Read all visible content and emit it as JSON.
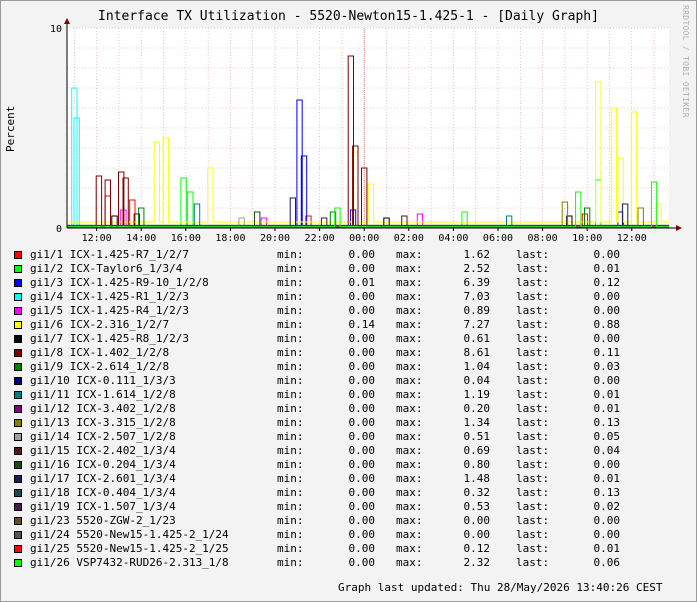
{
  "title": "Interface TX Utilization - 5520-Newton15-1.425-1 - [Daily Graph]",
  "side_text": "RRDTOOL / TOBI OETIKER",
  "labels": {
    "min": "min:",
    "max": "max:",
    "last": "last:"
  },
  "footer": "Graph last updated: Thu 28/May/2026 13:40:26 CEST",
  "chart_data": {
    "type": "line",
    "ylabel": "Percent",
    "ylim": [
      0,
      10
    ],
    "y_ticks": [
      "0",
      "10"
    ],
    "x_range_hours": [
      10.67,
      37.67
    ],
    "x_ticks": [
      {
        "label": "12:00",
        "h": 12
      },
      {
        "label": "14:00",
        "h": 14
      },
      {
        "label": "16:00",
        "h": 16
      },
      {
        "label": "18:00",
        "h": 18
      },
      {
        "label": "20:00",
        "h": 20
      },
      {
        "label": "22:00",
        "h": 22
      },
      {
        "label": "00:00",
        "h": 24
      },
      {
        "label": "02:00",
        "h": 26
      },
      {
        "label": "04:00",
        "h": 28
      },
      {
        "label": "06:00",
        "h": 30
      },
      {
        "label": "08:00",
        "h": 32
      },
      {
        "label": "10:00",
        "h": 34
      },
      {
        "label": "12:00",
        "h": 36
      }
    ],
    "midnight_hour": 24,
    "colors": {
      "background": "#ffffff",
      "grid": "#e0a0a0",
      "midnight": "#e06060",
      "axis": "#000000",
      "arrow": "#800000"
    },
    "series": [
      {
        "name": "gi1/1 ICX-1.425-R7_1/2/7",
        "color": "#ff0000",
        "min": "0.00",
        "max": "1.62",
        "last": "0.00",
        "peaks": [
          [
            12.5,
            1.6
          ],
          [
            13.6,
            1.4
          ],
          [
            21.5,
            0.6
          ],
          [
            33.9,
            0.7
          ]
        ]
      },
      {
        "name": "gi1/2 ICX-Taylor6_1/3/4",
        "color": "#00ff00",
        "min": "0.00",
        "max": "2.52",
        "last": "0.01",
        "peaks": [
          [
            15.9,
            2.5
          ],
          [
            16.2,
            1.8
          ],
          [
            28.5,
            0.8
          ],
          [
            34.5,
            2.4
          ]
        ]
      },
      {
        "name": "gi1/3 ICX-1.425-R9-10_1/2/8",
        "color": "#0000ff",
        "min": "0.01",
        "max": "6.39",
        "last": "0.12",
        "peaks": [
          [
            21.1,
            6.4
          ],
          [
            21.3,
            3.6
          ],
          [
            23.5,
            0.9
          ],
          [
            35.5,
            0.8
          ]
        ]
      },
      {
        "name": "gi1/4 ICX-1.425-R1_1/2/3",
        "color": "#00ffff",
        "min": "0.00",
        "max": "7.03",
        "last": "0.00",
        "peaks": [
          [
            11.0,
            7.0
          ],
          [
            11.1,
            5.5
          ]
        ]
      },
      {
        "name": "gi1/5 ICX-1.425-R4_1/2/3",
        "color": "#ff00ff",
        "min": "0.00",
        "max": "0.89",
        "last": "0.00",
        "peaks": [
          [
            13.2,
            0.9
          ],
          [
            19.5,
            0.5
          ],
          [
            26.5,
            0.7
          ]
        ]
      },
      {
        "name": "gi1/6 ICX-2.316_1/2/7",
        "color": "#ffff00",
        "min": "0.14",
        "max": "7.27",
        "last": "0.88",
        "peaks": [
          [
            14.7,
            4.3
          ],
          [
            15.1,
            4.5
          ],
          [
            17.1,
            3.0
          ],
          [
            23.6,
            3.8
          ],
          [
            24.3,
            2.2
          ],
          [
            34.5,
            7.3
          ],
          [
            35.2,
            6.0
          ],
          [
            35.5,
            3.5
          ],
          [
            36.1,
            5.8
          ],
          [
            37.2,
            1.2
          ]
        ]
      },
      {
        "name": "gi1/7 ICX-1.425-R8_1/2/3",
        "color": "#000000",
        "min": "0.00",
        "max": "0.61",
        "last": "0.00",
        "peaks": [
          [
            12.8,
            0.6
          ],
          [
            25.0,
            0.5
          ],
          [
            33.2,
            0.6
          ]
        ]
      },
      {
        "name": "gi1/8 ICX-1.402_1/2/8",
        "color": "#800000",
        "min": "0.00",
        "max": "8.61",
        "last": "0.11",
        "peaks": [
          [
            12.1,
            2.6
          ],
          [
            12.5,
            2.4
          ],
          [
            13.1,
            2.8
          ],
          [
            13.3,
            2.5
          ],
          [
            23.4,
            8.6
          ],
          [
            23.6,
            4.1
          ],
          [
            24.0,
            3.0
          ]
        ]
      },
      {
        "name": "gi1/9 ICX-2.614_1/2/8",
        "color": "#008000",
        "min": "0.00",
        "max": "1.04",
        "last": "0.03",
        "peaks": [
          [
            14.0,
            1.0
          ],
          [
            22.6,
            0.8
          ],
          [
            34.0,
            1.0
          ]
        ]
      },
      {
        "name": "gi1/10 ICX-0.111_1/3/3",
        "color": "#000080",
        "min": "0.00",
        "max": "0.04",
        "last": "0.00",
        "peaks": []
      },
      {
        "name": "gi1/11 ICX-1.614_1/2/8",
        "color": "#008080",
        "min": "0.00",
        "max": "1.19",
        "last": "0.01",
        "peaks": [
          [
            16.5,
            1.2
          ],
          [
            30.5,
            0.6
          ]
        ]
      },
      {
        "name": "gi1/12 ICX-3.402_1/2/8",
        "color": "#800080",
        "min": "0.00",
        "max": "0.20",
        "last": "0.01",
        "peaks": []
      },
      {
        "name": "gi1/13 ICX-3.315_1/2/8",
        "color": "#808000",
        "min": "0.00",
        "max": "1.34",
        "last": "0.13",
        "peaks": [
          [
            33.0,
            1.3
          ],
          [
            36.4,
            1.0
          ]
        ]
      },
      {
        "name": "gi1/14 ICX-2.507_1/2/8",
        "color": "#a0a0a0",
        "min": "0.00",
        "max": "0.51",
        "last": "0.05",
        "peaks": [
          [
            18.5,
            0.5
          ]
        ]
      },
      {
        "name": "gi1/15 ICX-2.402_1/3/4",
        "color": "#4a1a1a",
        "min": "0.00",
        "max": "0.69",
        "last": "0.04",
        "peaks": [
          [
            13.8,
            0.7
          ],
          [
            25.8,
            0.6
          ]
        ]
      },
      {
        "name": "gi1/16 ICX-0.204_1/3/4",
        "color": "#1a4a1a",
        "min": "0.00",
        "max": "0.80",
        "last": "0.00",
        "peaks": [
          [
            19.2,
            0.8
          ]
        ]
      },
      {
        "name": "gi1/17 ICX-2.601_1/3/4",
        "color": "#1a1a5a",
        "min": "0.00",
        "max": "1.48",
        "last": "0.01",
        "peaks": [
          [
            20.8,
            1.5
          ],
          [
            35.7,
            1.2
          ]
        ]
      },
      {
        "name": "gi1/18 ICX-0.404_1/3/4",
        "color": "#1a4a4a",
        "min": "0.00",
        "max": "0.32",
        "last": "0.13",
        "peaks": []
      },
      {
        "name": "gi1/19 ICX-1.507_1/3/4",
        "color": "#4a1a4a",
        "min": "0.00",
        "max": "0.53",
        "last": "0.02",
        "peaks": [
          [
            22.2,
            0.5
          ]
        ]
      },
      {
        "name": "gi1/23 5520-ZGW-2_1/23",
        "color": "#5a5020",
        "min": "0.00",
        "max": "0.00",
        "last": "0.00",
        "peaks": []
      },
      {
        "name": "gi1/24 5520-New15-1.425-2_1/24",
        "color": "#555555",
        "min": "0.00",
        "max": "0.00",
        "last": "0.00",
        "peaks": []
      },
      {
        "name": "gi1/25 5520-New15-1.425-2_1/25",
        "color": "#ff0000",
        "min": "0.00",
        "max": "0.12",
        "last": "0.01",
        "peaks": []
      },
      {
        "name": "gi1/26 VSP7432-RUD26-2.313_1/8",
        "color": "#00ff00",
        "min": "0.00",
        "max": "2.32",
        "last": "0.06",
        "peaks": [
          [
            22.8,
            1.0
          ],
          [
            33.6,
            1.8
          ],
          [
            37.0,
            2.3
          ]
        ]
      }
    ]
  }
}
